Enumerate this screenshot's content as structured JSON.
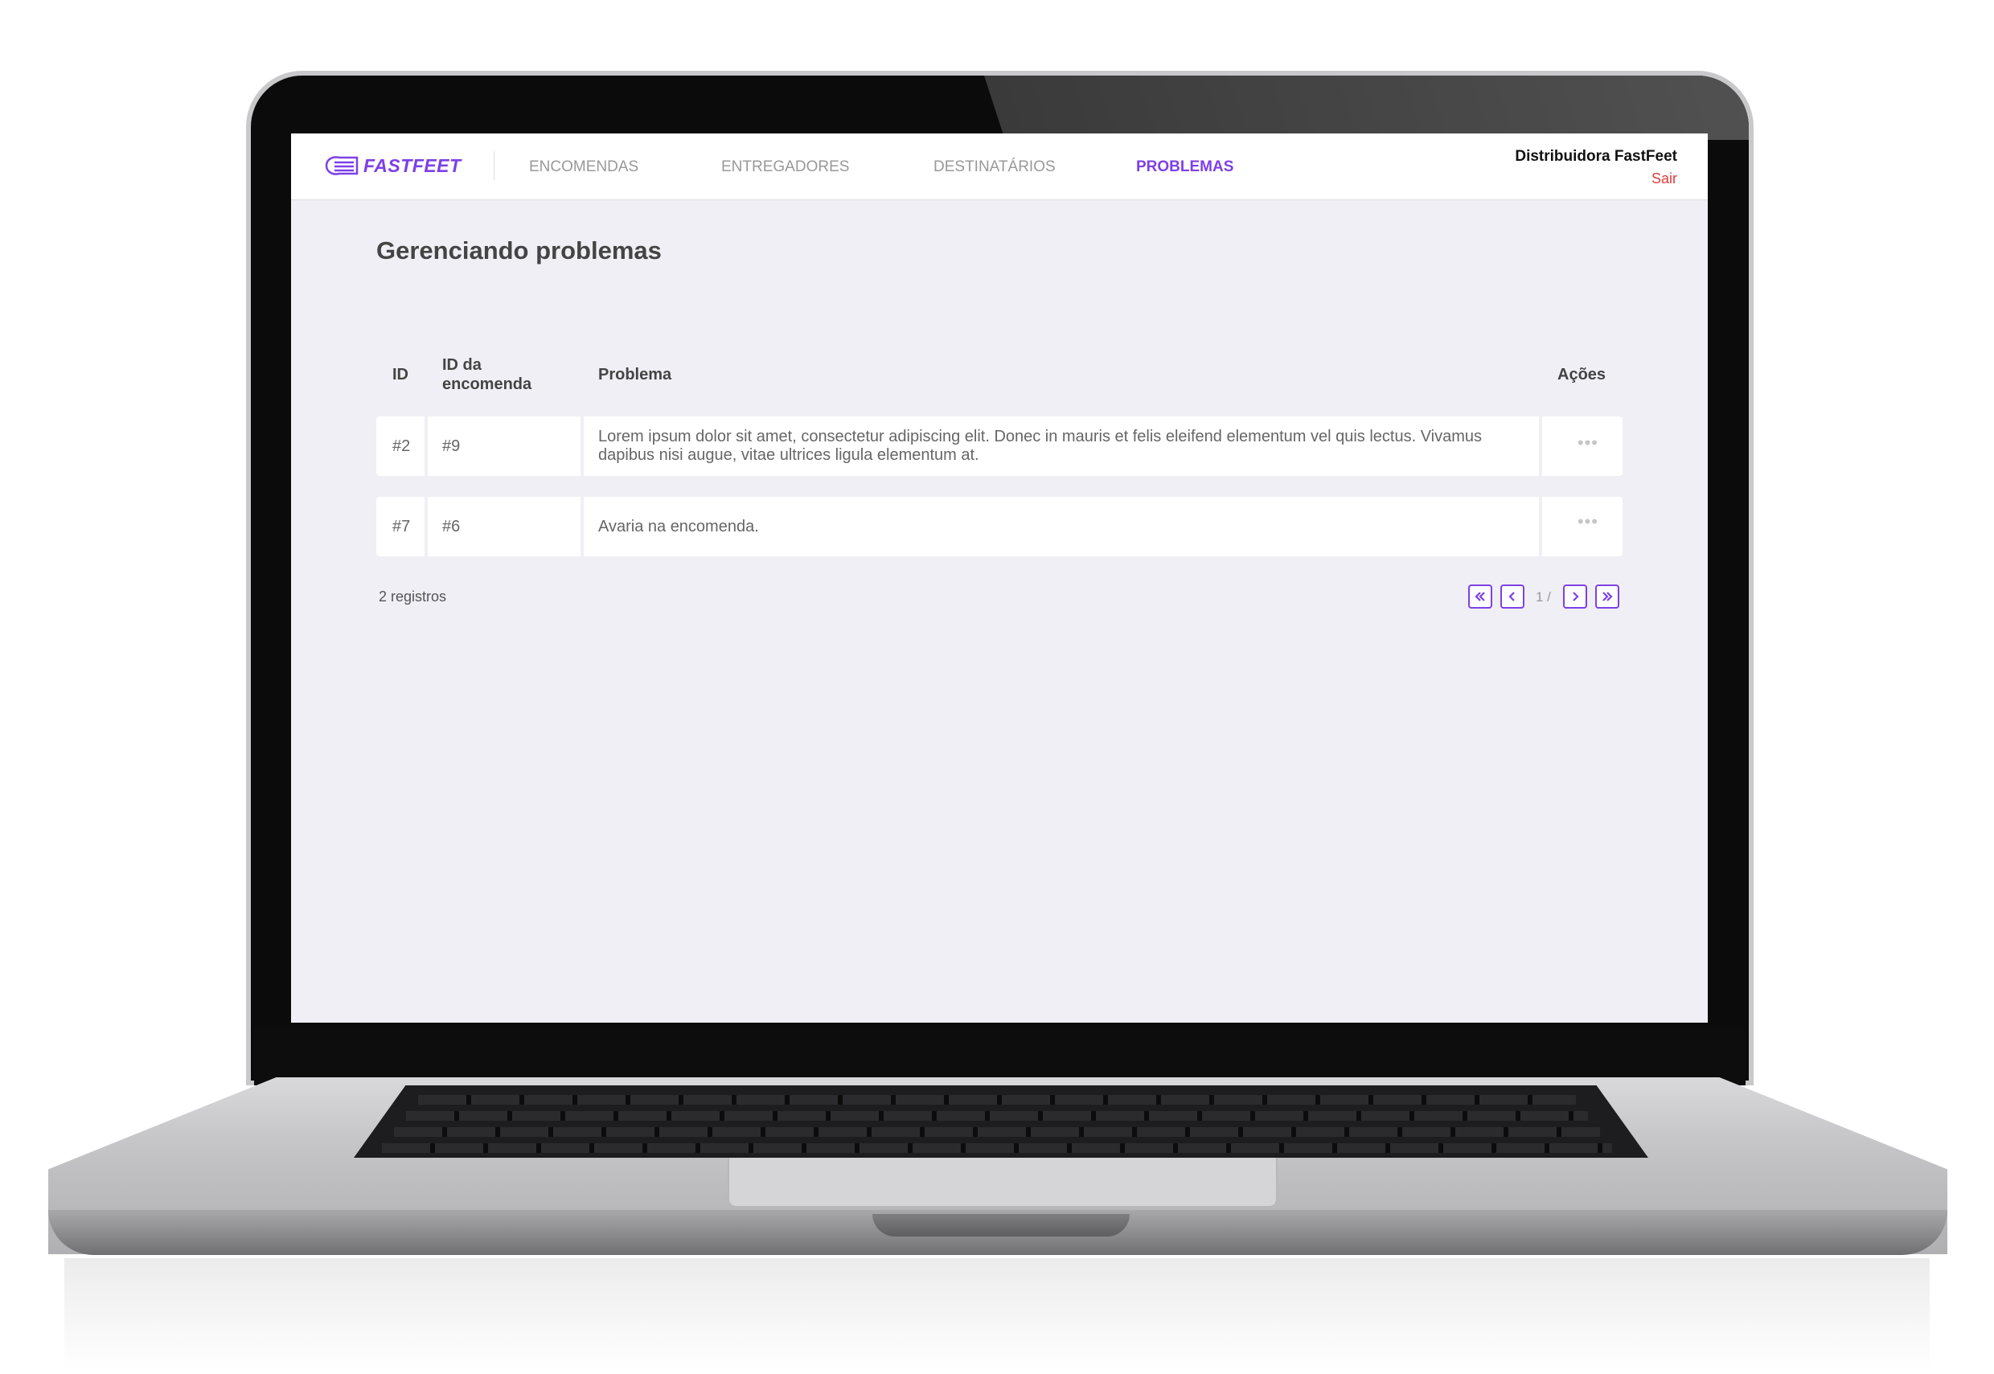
{
  "brand": {
    "name": "FASTFEET",
    "color": "#7d40e7",
    "icon": "truck-speed-icon"
  },
  "nav": {
    "items": [
      {
        "label": "ENCOMENDAS",
        "active": false
      },
      {
        "label": "ENTREGADORES",
        "active": false
      },
      {
        "label": "DESTINATÁRIOS",
        "active": false
      },
      {
        "label": "PROBLEMAS",
        "active": true
      }
    ]
  },
  "user": {
    "name": "Distribuidora FastFeet",
    "logout_label": "Sair"
  },
  "page": {
    "title": "Gerenciando problemas"
  },
  "table": {
    "headers": {
      "id": "ID",
      "order_id": "ID da encomenda",
      "problem": "Problema",
      "actions": "Ações"
    },
    "rows": [
      {
        "id": "#2",
        "order_id": "#9",
        "problem": "Lorem ipsum dolor sit amet, consectetur adipiscing elit. Donec in mauris et felis eleifend elementum vel quis lectus. Vivamus dapibus nisi augue, vitae ultrices ligula elementum at.",
        "actions_icon": "ellipsis-icon"
      },
      {
        "id": "#7",
        "order_id": "#6",
        "problem": "Avaria na encomenda.",
        "actions_icon": "ellipsis-icon"
      }
    ]
  },
  "footer": {
    "records_label": "2 registros",
    "pagination": {
      "current_text": "1 /"
    }
  },
  "colors": {
    "accent": "#7d40e7",
    "danger": "#de3b3b",
    "background": "#f0eff5"
  }
}
